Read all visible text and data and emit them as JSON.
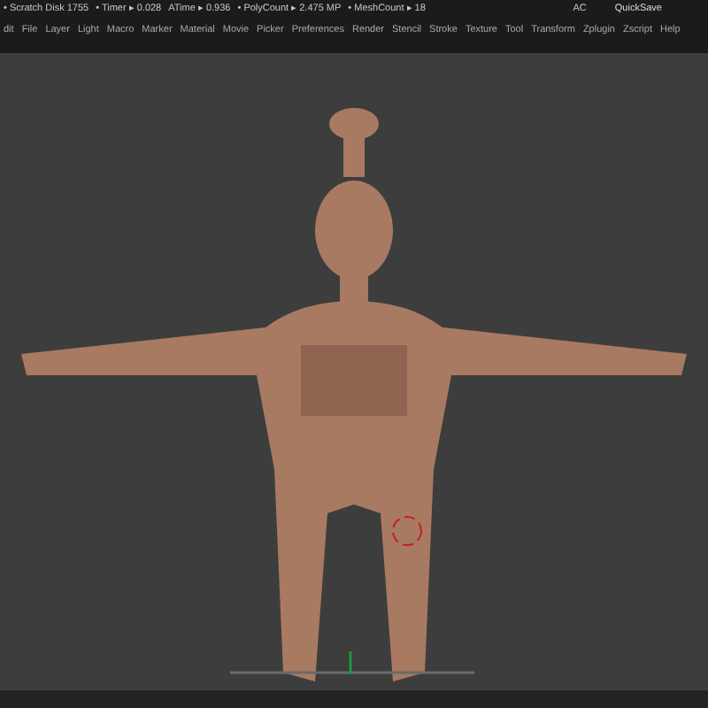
{
  "status_bar": {
    "items": [
      "• Scratch Disk 1755",
      "• Timer ▸ 0.028",
      "ATime ▸ 0.936",
      "• PolyCount ▸ 2.475 MP",
      "• MeshCount ▸ 18"
    ],
    "right": [
      "AC",
      "QuickSave"
    ]
  },
  "menu": [
    "dit",
    "File",
    "Layer",
    "Light",
    "Macro",
    "Marker",
    "Material",
    "Movie",
    "Picker",
    "Preferences",
    "Render",
    "Stencil",
    "Stroke",
    "Texture",
    "Tool",
    "Transform",
    "Zplugin",
    "Zscript",
    "Help"
  ]
}
